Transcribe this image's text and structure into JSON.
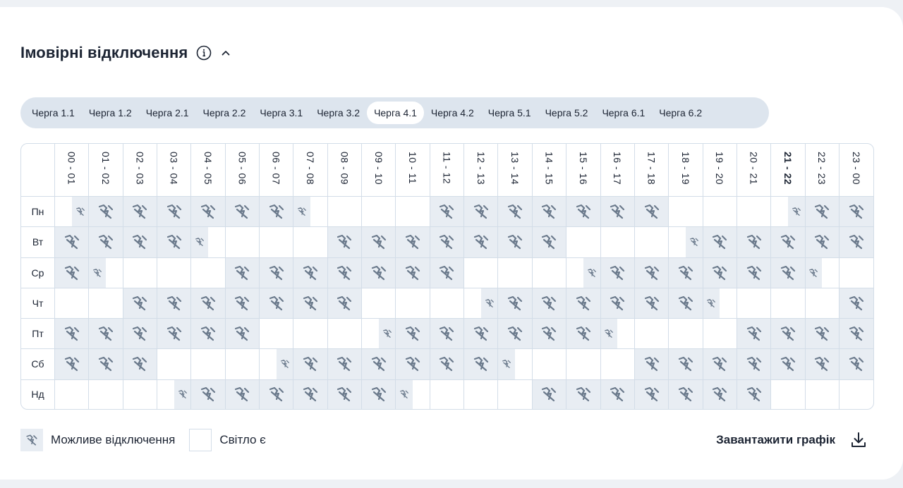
{
  "header": {
    "title": "Імовірні відключення"
  },
  "icons": {
    "info": "info-icon",
    "collapse": "chevron-up-icon",
    "outage": "power-off-icon",
    "download": "download-icon"
  },
  "tabs": [
    {
      "label": "Черга 1.1",
      "active": false
    },
    {
      "label": "Черга 1.2",
      "active": false
    },
    {
      "label": "Черга 2.1",
      "active": false
    },
    {
      "label": "Черга 2.2",
      "active": false
    },
    {
      "label": "Черга 3.1",
      "active": false
    },
    {
      "label": "Черга 3.2",
      "active": false
    },
    {
      "label": "Черга 4.1",
      "active": true
    },
    {
      "label": "Черга 4.2",
      "active": false
    },
    {
      "label": "Черга 5.1",
      "active": false
    },
    {
      "label": "Черга 5.2",
      "active": false
    },
    {
      "label": "Черга 6.1",
      "active": false
    },
    {
      "label": "Черга 6.2",
      "active": false
    }
  ],
  "schedule": {
    "hours": [
      "00 - 01",
      "01 - 02",
      "02 - 03",
      "03 - 04",
      "04 - 05",
      "05 - 06",
      "06 - 07",
      "07 - 08",
      "08 - 09",
      "09 - 10",
      "10 - 11",
      "11 - 12",
      "12 - 13",
      "13 - 14",
      "14 - 15",
      "15 - 16",
      "16 - 17",
      "17 - 18",
      "18 - 19",
      "19 - 20",
      "20 - 21",
      "21 - 22",
      "22 - 23",
      "23 - 00"
    ],
    "current_hour_index": 21,
    "legend_states": {
      "full": "F",
      "second_half": "R",
      "first_half": "L",
      "power_on": "."
    },
    "days": [
      {
        "label": "Пн",
        "cells": [
          "R",
          "F",
          "F",
          "F",
          "F",
          "F",
          "F",
          "L",
          ".",
          ".",
          ".",
          "F",
          "F",
          "F",
          "F",
          "F",
          "F",
          "F",
          ".",
          ".",
          ".",
          "R",
          "F",
          "F"
        ]
      },
      {
        "label": "Вт",
        "cells": [
          "F",
          "F",
          "F",
          "F",
          "L",
          ".",
          ".",
          ".",
          "F",
          "F",
          "F",
          "F",
          "F",
          "F",
          "F",
          ".",
          ".",
          ".",
          "R",
          "F",
          "F",
          "F",
          "F",
          "F"
        ]
      },
      {
        "label": "Ср",
        "cells": [
          "F",
          "L",
          ".",
          ".",
          ".",
          "F",
          "F",
          "F",
          "F",
          "F",
          "F",
          "F",
          ".",
          ".",
          ".",
          "R",
          "F",
          "F",
          "F",
          "F",
          "F",
          "F",
          "L",
          "."
        ]
      },
      {
        "label": "Чт",
        "cells": [
          ".",
          ".",
          "F",
          "F",
          "F",
          "F",
          "F",
          "F",
          "F",
          ".",
          ".",
          ".",
          "R",
          "F",
          "F",
          "F",
          "F",
          "F",
          "F",
          "L",
          ".",
          ".",
          ".",
          "F"
        ]
      },
      {
        "label": "Пт",
        "cells": [
          "F",
          "F",
          "F",
          "F",
          "F",
          "F",
          ".",
          ".",
          ".",
          "R",
          "F",
          "F",
          "F",
          "F",
          "F",
          "F",
          "L",
          ".",
          ".",
          ".",
          "F",
          "F",
          "F",
          "F"
        ]
      },
      {
        "label": "Сб",
        "cells": [
          "F",
          "F",
          "F",
          ".",
          ".",
          ".",
          "R",
          "F",
          "F",
          "F",
          "F",
          "F",
          "F",
          "L",
          ".",
          ".",
          ".",
          "F",
          "F",
          "F",
          "F",
          "F",
          "F",
          "F"
        ]
      },
      {
        "label": "Нд",
        "cells": [
          ".",
          ".",
          ".",
          "R",
          "F",
          "F",
          "F",
          "F",
          "F",
          "F",
          "L",
          ".",
          ".",
          ".",
          "F",
          "F",
          "F",
          "F",
          "F",
          "F",
          "F",
          ".",
          ".",
          "."
        ]
      }
    ]
  },
  "legend": {
    "outage_label": "Можливе відключення",
    "power_on_label": "Світло є"
  },
  "download": {
    "label": "Завантажити графік"
  }
}
